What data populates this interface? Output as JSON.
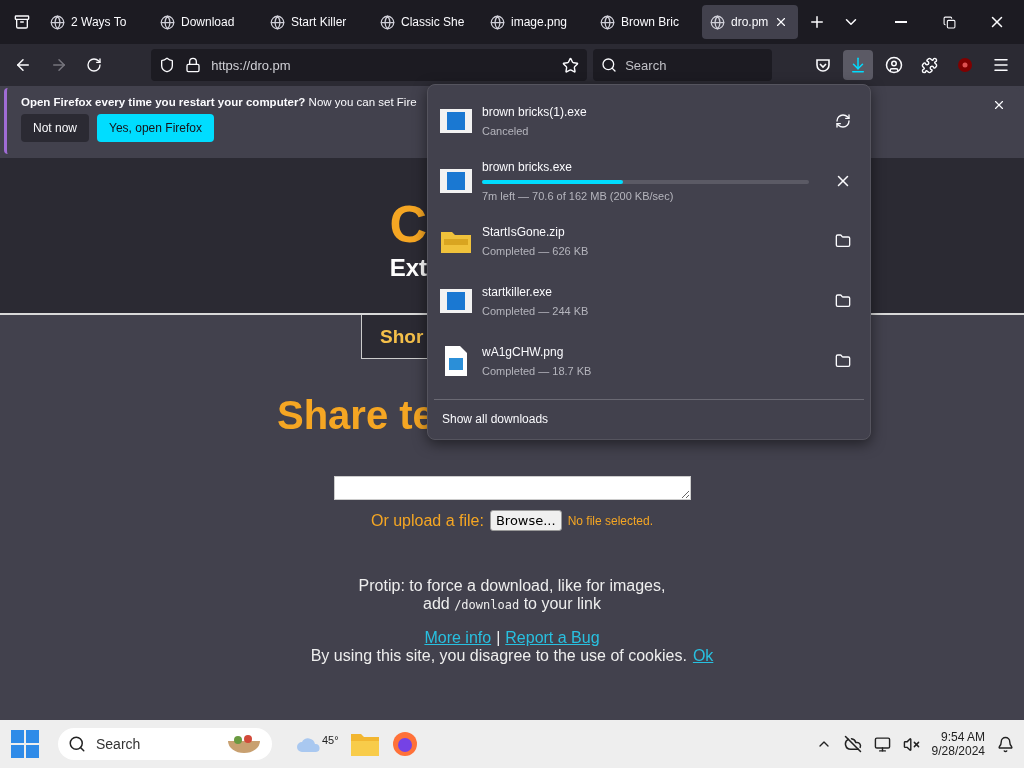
{
  "tabs": [
    {
      "title": "2 Ways To",
      "selected": false
    },
    {
      "title": "Download",
      "selected": false
    },
    {
      "title": "Start Killer",
      "selected": false
    },
    {
      "title": "Classic She",
      "selected": false
    },
    {
      "title": "image.png",
      "selected": false
    },
    {
      "title": "Brown Bric",
      "selected": false
    },
    {
      "title": "dro.pm",
      "selected": true
    }
  ],
  "address_bar": {
    "url": "https://dro.pm"
  },
  "search_bar": {
    "placeholder": "Search"
  },
  "notification": {
    "message": "**Open Firefox every time you restart your computer?** Now you can set Fire",
    "buttons": [
      {
        "label": "Not now",
        "kind": "secondary"
      },
      {
        "label": "Yes, open Firefox",
        "kind": "primary"
      }
    ]
  },
  "page": {
    "logo_fragment": "C",
    "subtitle_fragment": "Ext",
    "nav_button_fragment": "Shor",
    "heading_fragment": "Share te",
    "upload_label": "Or upload a file:",
    "browse_button": "Browse...",
    "file_status": "No file selected.",
    "protip": "Protip: to force a download, like for images,",
    "protip_line2_start": "add",
    "protip_code": "/download",
    "protip_line2_end": "to your link",
    "links": [
      "More info",
      "Report a Bug"
    ],
    "link_separator": "|",
    "cookie_text": "By using this site, you disagree to the use of cookies.",
    "cookie_link": "Ok"
  },
  "downloads_panel": {
    "items": [
      {
        "name": "brown bricks(1).exe",
        "kind": "program",
        "canceled": true,
        "in_progress": false,
        "detail": "Canceled"
      },
      {
        "name": "brown bricks.exe",
        "kind": "program",
        "canceled": false,
        "in_progress": true,
        "level": 0.43,
        "detail": "7m left — 70.6 of 162 MB (200 KB/sec)"
      },
      {
        "name": "StartIsGone.zip",
        "kind": "archive",
        "canceled": false,
        "in_progress": false,
        "detail": "Completed — 626 KB"
      },
      {
        "name": "startkiller.exe",
        "kind": "program",
        "canceled": false,
        "in_progress": false,
        "detail": "Completed — 244 KB"
      },
      {
        "name": "wA1gCHW.png",
        "kind": "image",
        "canceled": false,
        "in_progress": false,
        "detail": "Completed — 18.7 KB"
      }
    ],
    "show_all": "Show all downloads"
  },
  "taskbar": {
    "search_placeholder": "Search",
    "weather": "45°",
    "time": "9:54 AM",
    "date": "9/28/2024"
  }
}
